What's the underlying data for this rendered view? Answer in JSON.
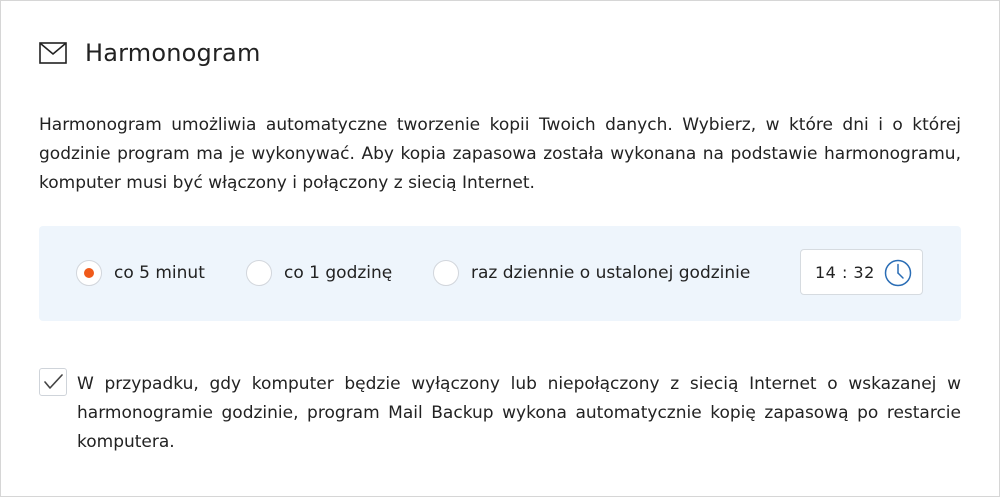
{
  "header": {
    "title": "Harmonogram",
    "icon": "envelope-icon"
  },
  "intro": {
    "text": "Harmonogram umożliwia automatyczne tworzenie kopii Twoich danych. Wybierz, w które dni i o której godzinie program ma je wykonywać. Aby kopia zapasowa została wykonana na podstawie harmonogramu, komputer musi być włączony i połączony z siecią Internet."
  },
  "schedule": {
    "options": [
      {
        "label": "co 5 minut",
        "checked": true
      },
      {
        "label": "co 1 godzinę",
        "checked": false
      },
      {
        "label": "raz dziennie o ustalonej godzinie",
        "checked": false
      }
    ],
    "time": {
      "value": "14 : 32",
      "icon": "clock-icon"
    },
    "accent_color": "#f05a1a",
    "panel_color": "#eef5fc"
  },
  "catchup": {
    "checked": true,
    "text": "W przypadku, gdy komputer będzie wyłączony lub niepołączony z siecią Internet o wskazanej w harmonogramie godzinie, program Mail Backup wykona automatycznie kopię zapasową po restarcie komputera."
  }
}
